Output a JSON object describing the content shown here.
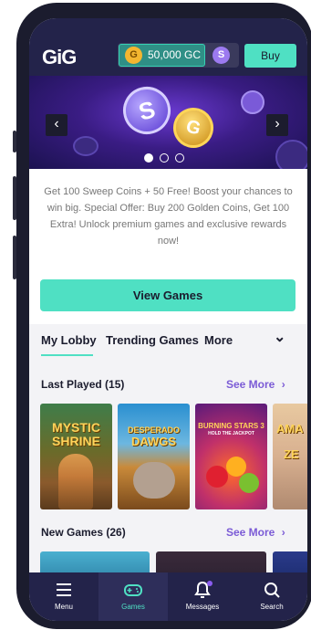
{
  "header": {
    "logo": "GiG",
    "balance": "50,000 GC",
    "gold_coin_letter": "G",
    "sweep_coin_letter": "S",
    "buy_label": "Buy"
  },
  "banner": {
    "prev_arrow": "‹",
    "next_arrow": "›",
    "dots": 3,
    "active_dot": 1
  },
  "promo": {
    "text": "Get 100 Sweep Coins + 50 Free! Boost your chances to win big. Special Offer: Buy 200 Golden Coins, Get 100 Extra! Unlock premium games and exclusive rewards now!",
    "view_games_label": "View Games"
  },
  "tabs": {
    "my_lobby": "My Lobby",
    "trending": "Trending Games",
    "more": "More",
    "chevron": "⌄"
  },
  "last_played": {
    "title": "Last Played (15)",
    "see_more": "See More",
    "chevron": "›",
    "games": [
      {
        "title_line1": "MYSTIC",
        "title_line2": "SHRINE"
      },
      {
        "title_line1": "DESPERADO",
        "title_line2": "DAWGS"
      },
      {
        "title_line1": "BURNING STARS 3",
        "title_line2": "HOLD THE JACKPOT"
      },
      {
        "title_line1": "AMA",
        "title_line2": "ZE"
      }
    ]
  },
  "new_games": {
    "title": "New Games (26)",
    "see_more": "See More",
    "chevron": "›"
  },
  "bottom_nav": {
    "items": [
      {
        "label": "Menu",
        "icon": "hamburger-icon"
      },
      {
        "label": "Games",
        "icon": "gamepad-icon"
      },
      {
        "label": "Messages",
        "icon": "bell-icon"
      },
      {
        "label": "Search",
        "icon": "search-icon"
      }
    ],
    "active_index": 1
  },
  "colors": {
    "accent": "#4fe0c3",
    "header_bg": "#23234a",
    "see_more": "#7b5bd6"
  }
}
